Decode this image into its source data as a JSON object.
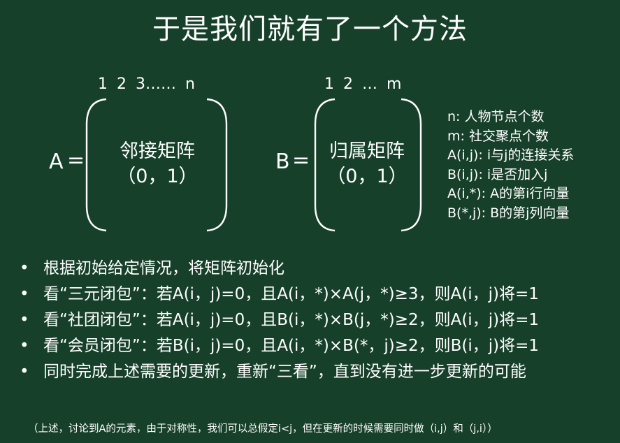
{
  "title": "于是我们就有了一个方法",
  "matrix_a": {
    "indices": "1 2 3…… n",
    "label": "A",
    "equals": "=",
    "name": "邻接矩阵",
    "values": "（0，1）"
  },
  "matrix_b": {
    "indices": "1 2 … m",
    "label": "B",
    "equals": "=",
    "name": "归属矩阵",
    "values": "（0，1）"
  },
  "legend": [
    "n: 人物节点个数",
    "m: 社交聚点个数",
    "A(i,j): i与j的连接关系",
    "B(i,j): i是否加入j",
    "A(i,*): A的第i行向量",
    "B(*,j): B的第j列向量"
  ],
  "bullets": [
    {
      "marker": "•",
      "text": "根据初始给定情况，将矩阵初始化"
    },
    {
      "marker": "•",
      "text": "看“三元闭包”：若A(i，j)=0，且A(i，*)×A(j，*)≥3，则A(i，j)将=1"
    },
    {
      "marker": "•",
      "text": "看“社团闭包”：若A(i，j)=0，且B(i，*)×B(j，*)≥2，则A(i，j)将=1"
    },
    {
      "marker": "•",
      "text": "看“会员闭包”：若B(i，j)=0，且A(i，*)×B(*，j)≥2，则B(i，j)将=1"
    },
    {
      "marker": "•",
      "text": "同时完成上述需要的更新，重新“三看”，直到没有进一步更新的可能"
    }
  ],
  "footnote": "（上述，讨论到A的元素，由于对称性，我们可以总假定i<j，但在更新的时候需要同时做（i,j）和（j,i））",
  "colors": {
    "background": "#17402a",
    "text": "#ffffff"
  }
}
